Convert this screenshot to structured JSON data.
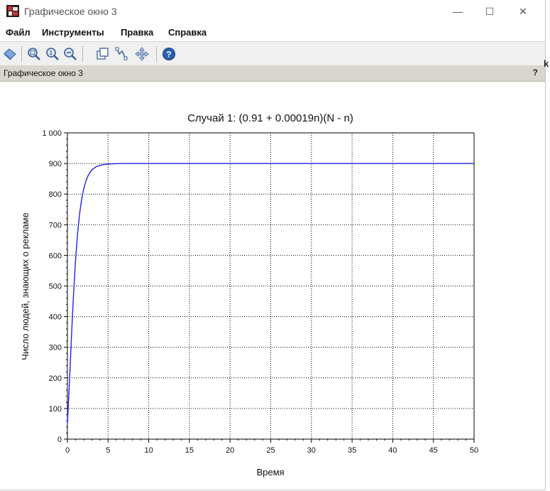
{
  "window": {
    "title": "Графическое окно 3",
    "controls": {
      "minimize": "—",
      "maximize": "☐",
      "close": "✕"
    }
  },
  "menu": {
    "items": [
      "Файл",
      "Инструменты",
      "Правка",
      "Справка"
    ]
  },
  "toolbar": {
    "icons": [
      "rotate-icon",
      "zoom-in-icon",
      "zoom-reset-icon",
      "zoom-out-icon",
      "datatip-icon",
      "edit-curve-icon",
      "pan-icon",
      "help-icon"
    ]
  },
  "panel": {
    "title": "Графическое окно 3",
    "help_label": "?"
  },
  "side_glyph": "k",
  "colors": {
    "curve": "#2323e6",
    "panel_header": "#d9d6cf",
    "toolbar": "#f0f0f0"
  },
  "chart_data": {
    "type": "line",
    "title": "Случай 1: (0.91 + 0.00019n)(N - n)",
    "xlabel": "Время",
    "ylabel": "Число людей, знающих о рекламе",
    "xlim": [
      0,
      50
    ],
    "ylim": [
      0,
      1000
    ],
    "x_ticks": [
      0,
      5,
      10,
      15,
      20,
      25,
      30,
      35,
      40,
      45,
      50
    ],
    "y_ticks": [
      0,
      100,
      200,
      300,
      400,
      500,
      600,
      700,
      800,
      900,
      1000
    ],
    "y_tick_labels": [
      "0",
      "100",
      "200",
      "300",
      "400",
      "500",
      "600",
      "700",
      "800",
      "900",
      "1 000"
    ],
    "grid": true,
    "series": [
      {
        "color": "#2323e6",
        "x": [
          0,
          0.25,
          0.5,
          0.75,
          1,
          1.25,
          1.5,
          1.75,
          2,
          2.25,
          2.5,
          2.75,
          3,
          3.5,
          4,
          4.5,
          5,
          5.5,
          6,
          7,
          8,
          10,
          15,
          20,
          25,
          30,
          35,
          40,
          45,
          50
        ],
        "y": [
          50,
          185,
          336,
          472,
          584,
          671,
          736,
          783,
          817,
          841,
          858,
          870,
          879,
          889,
          894,
          897,
          898,
          899,
          899.5,
          899.8,
          900,
          900,
          900,
          900,
          900,
          900,
          900,
          900,
          900,
          900
        ]
      }
    ]
  }
}
